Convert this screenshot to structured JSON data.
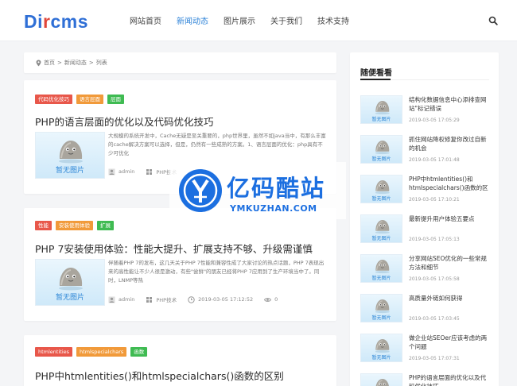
{
  "logo": {
    "part1": "Di",
    "part2": "r",
    "part3": "cms"
  },
  "nav": [
    {
      "label": "网站首页",
      "active": false
    },
    {
      "label": "新闻动态",
      "active": true
    },
    {
      "label": "图片展示",
      "active": false
    },
    {
      "label": "关于我们",
      "active": false
    },
    {
      "label": "技术支持",
      "active": false
    }
  ],
  "breadcrumb": {
    "home": "首页",
    "sep1": ">",
    "section": "新闻动态",
    "sep2": ">",
    "current": "列表"
  },
  "no_image_text": "暂无图片",
  "articles": [
    {
      "tags": [
        "代码优化技巧",
        "语言层面",
        "层面"
      ],
      "title": "PHP的语言层面的优化以及代码优化技巧",
      "excerpt": "大规模的系统开发中，Cache无疑是至关重要的，php世界里，虽然不如java当中，有那么丰富的cache解决方案可以选择，但是，仍然有一些成熟的方案。1、语言层面的优化：php具有不少可优化",
      "author": "admin",
      "category": "PHP技术",
      "date": "",
      "views": ""
    },
    {
      "tags": [
        "性能",
        "安装使用体验",
        "扩展"
      ],
      "title": "PHP 7安装使用体验：性能大提升、扩展支持不够、升级需谨慎",
      "excerpt": "伴随着PHP 7的发布，这几天关于PHP 7性能和兼容性成了大家讨论的热点话题，PHP 7表现出来的高性能让不少人很是激动，有些\"尝鲜\"的朋友已经将PHP 7应用到了生产环境当中了。同时，LNMP等热",
      "author": "admin",
      "category": "PHP技术",
      "date": "2019-03-05 17:12:52",
      "views": "0"
    },
    {
      "tags": [
        "htmlentities",
        "htmlspecialchars",
        "函数"
      ],
      "title": "PHP中htmlentities()和htmlspecialchars()函数的区别"
    }
  ],
  "sidebar": {
    "title": "随便看看",
    "items": [
      {
        "title": "结构化数据信息中心添排查网站\"标记错误",
        "date": "2019-03-05 17:05:29"
      },
      {
        "title": "抓住网站降权修复你改过自新的机会",
        "date": "2019-03-05 17:01:48"
      },
      {
        "title": "PHP中htmlentities()和htmlspecialchars()函数的区别",
        "date": "2019-03-05 17:10:21"
      },
      {
        "title": "最新提升用户体验五要点",
        "date": "2019-03-05 17:05:13"
      },
      {
        "title": "分享网站SEO优化的一些常规方法和细节",
        "date": "2019-03-05 17:05:58"
      },
      {
        "title": "高质量外链如何获得",
        "date": "2019-03-05 17:03:45"
      },
      {
        "title": "做企业站SEOer应该考虑的两个问题",
        "date": "2019-03-05 17:07:31"
      },
      {
        "title": "PHP的语言层面的优化以及代码优化技巧",
        "date": ""
      }
    ]
  },
  "watermark": {
    "cn": "亿码酷站",
    "en": "YMKUZHAN.COM"
  },
  "colors": {
    "accent": "#2e83d8",
    "tag_red": "#e8574a",
    "tag_orange": "#f19a3a",
    "tag_green": "#3fbb52",
    "watermark": "#1c6fe0"
  },
  "icons": [
    "search-icon",
    "location-icon",
    "user-icon",
    "category-icon",
    "clock-icon",
    "eye-icon"
  ]
}
